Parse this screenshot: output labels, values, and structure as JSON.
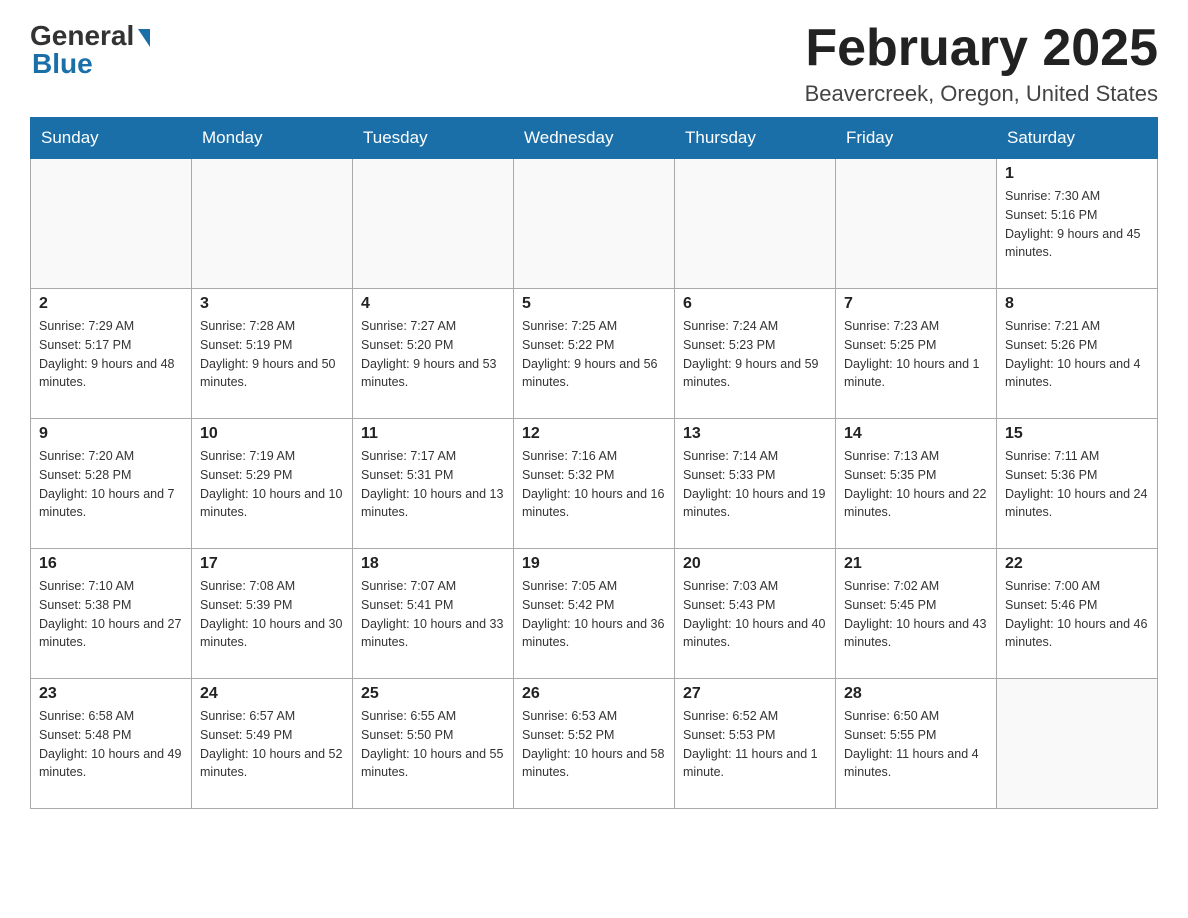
{
  "header": {
    "logo_general": "General",
    "logo_blue": "Blue",
    "title": "February 2025",
    "location": "Beavercreek, Oregon, United States"
  },
  "days_of_week": [
    "Sunday",
    "Monday",
    "Tuesday",
    "Wednesday",
    "Thursday",
    "Friday",
    "Saturday"
  ],
  "weeks": [
    [
      {
        "day": "",
        "info": ""
      },
      {
        "day": "",
        "info": ""
      },
      {
        "day": "",
        "info": ""
      },
      {
        "day": "",
        "info": ""
      },
      {
        "day": "",
        "info": ""
      },
      {
        "day": "",
        "info": ""
      },
      {
        "day": "1",
        "info": "Sunrise: 7:30 AM\nSunset: 5:16 PM\nDaylight: 9 hours and 45 minutes."
      }
    ],
    [
      {
        "day": "2",
        "info": "Sunrise: 7:29 AM\nSunset: 5:17 PM\nDaylight: 9 hours and 48 minutes."
      },
      {
        "day": "3",
        "info": "Sunrise: 7:28 AM\nSunset: 5:19 PM\nDaylight: 9 hours and 50 minutes."
      },
      {
        "day": "4",
        "info": "Sunrise: 7:27 AM\nSunset: 5:20 PM\nDaylight: 9 hours and 53 minutes."
      },
      {
        "day": "5",
        "info": "Sunrise: 7:25 AM\nSunset: 5:22 PM\nDaylight: 9 hours and 56 minutes."
      },
      {
        "day": "6",
        "info": "Sunrise: 7:24 AM\nSunset: 5:23 PM\nDaylight: 9 hours and 59 minutes."
      },
      {
        "day": "7",
        "info": "Sunrise: 7:23 AM\nSunset: 5:25 PM\nDaylight: 10 hours and 1 minute."
      },
      {
        "day": "8",
        "info": "Sunrise: 7:21 AM\nSunset: 5:26 PM\nDaylight: 10 hours and 4 minutes."
      }
    ],
    [
      {
        "day": "9",
        "info": "Sunrise: 7:20 AM\nSunset: 5:28 PM\nDaylight: 10 hours and 7 minutes."
      },
      {
        "day": "10",
        "info": "Sunrise: 7:19 AM\nSunset: 5:29 PM\nDaylight: 10 hours and 10 minutes."
      },
      {
        "day": "11",
        "info": "Sunrise: 7:17 AM\nSunset: 5:31 PM\nDaylight: 10 hours and 13 minutes."
      },
      {
        "day": "12",
        "info": "Sunrise: 7:16 AM\nSunset: 5:32 PM\nDaylight: 10 hours and 16 minutes."
      },
      {
        "day": "13",
        "info": "Sunrise: 7:14 AM\nSunset: 5:33 PM\nDaylight: 10 hours and 19 minutes."
      },
      {
        "day": "14",
        "info": "Sunrise: 7:13 AM\nSunset: 5:35 PM\nDaylight: 10 hours and 22 minutes."
      },
      {
        "day": "15",
        "info": "Sunrise: 7:11 AM\nSunset: 5:36 PM\nDaylight: 10 hours and 24 minutes."
      }
    ],
    [
      {
        "day": "16",
        "info": "Sunrise: 7:10 AM\nSunset: 5:38 PM\nDaylight: 10 hours and 27 minutes."
      },
      {
        "day": "17",
        "info": "Sunrise: 7:08 AM\nSunset: 5:39 PM\nDaylight: 10 hours and 30 minutes."
      },
      {
        "day": "18",
        "info": "Sunrise: 7:07 AM\nSunset: 5:41 PM\nDaylight: 10 hours and 33 minutes."
      },
      {
        "day": "19",
        "info": "Sunrise: 7:05 AM\nSunset: 5:42 PM\nDaylight: 10 hours and 36 minutes."
      },
      {
        "day": "20",
        "info": "Sunrise: 7:03 AM\nSunset: 5:43 PM\nDaylight: 10 hours and 40 minutes."
      },
      {
        "day": "21",
        "info": "Sunrise: 7:02 AM\nSunset: 5:45 PM\nDaylight: 10 hours and 43 minutes."
      },
      {
        "day": "22",
        "info": "Sunrise: 7:00 AM\nSunset: 5:46 PM\nDaylight: 10 hours and 46 minutes."
      }
    ],
    [
      {
        "day": "23",
        "info": "Sunrise: 6:58 AM\nSunset: 5:48 PM\nDaylight: 10 hours and 49 minutes."
      },
      {
        "day": "24",
        "info": "Sunrise: 6:57 AM\nSunset: 5:49 PM\nDaylight: 10 hours and 52 minutes."
      },
      {
        "day": "25",
        "info": "Sunrise: 6:55 AM\nSunset: 5:50 PM\nDaylight: 10 hours and 55 minutes."
      },
      {
        "day": "26",
        "info": "Sunrise: 6:53 AM\nSunset: 5:52 PM\nDaylight: 10 hours and 58 minutes."
      },
      {
        "day": "27",
        "info": "Sunrise: 6:52 AM\nSunset: 5:53 PM\nDaylight: 11 hours and 1 minute."
      },
      {
        "day": "28",
        "info": "Sunrise: 6:50 AM\nSunset: 5:55 PM\nDaylight: 11 hours and 4 minutes."
      },
      {
        "day": "",
        "info": ""
      }
    ]
  ]
}
